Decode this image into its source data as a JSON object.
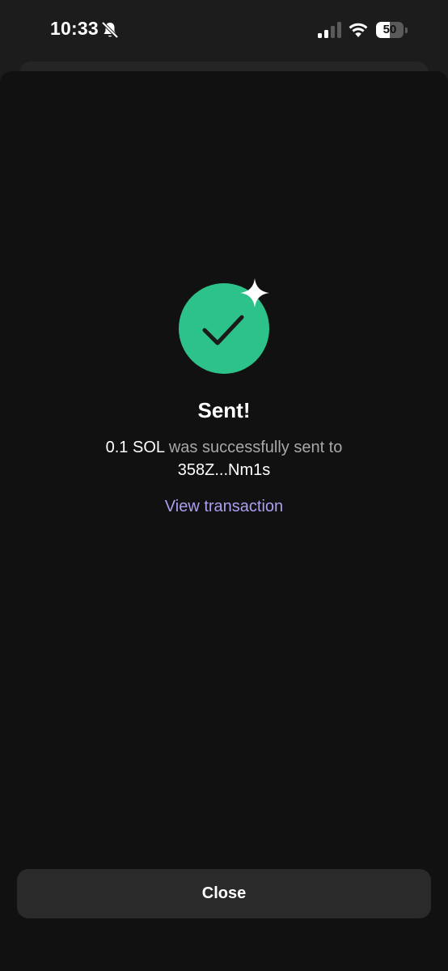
{
  "status_bar": {
    "time": "10:33",
    "battery_level": "50",
    "battery_fraction": 0.5,
    "icons": [
      "bell-slash-icon",
      "cellular-signal-icon",
      "wifi-icon",
      "battery-icon"
    ]
  },
  "result": {
    "title": "Sent!",
    "amount": "0.1 SOL",
    "message_middle": "was successfully sent to",
    "recipient": "358Z...Nm1s",
    "link_label": "View transaction",
    "icons": [
      "checkmark-icon",
      "sparkle-icon"
    ]
  },
  "footer": {
    "close_label": "Close"
  },
  "colors": {
    "success": "#2ec28b",
    "link": "#ab9ff2",
    "background": "#111111",
    "button": "#2a2a2a"
  }
}
